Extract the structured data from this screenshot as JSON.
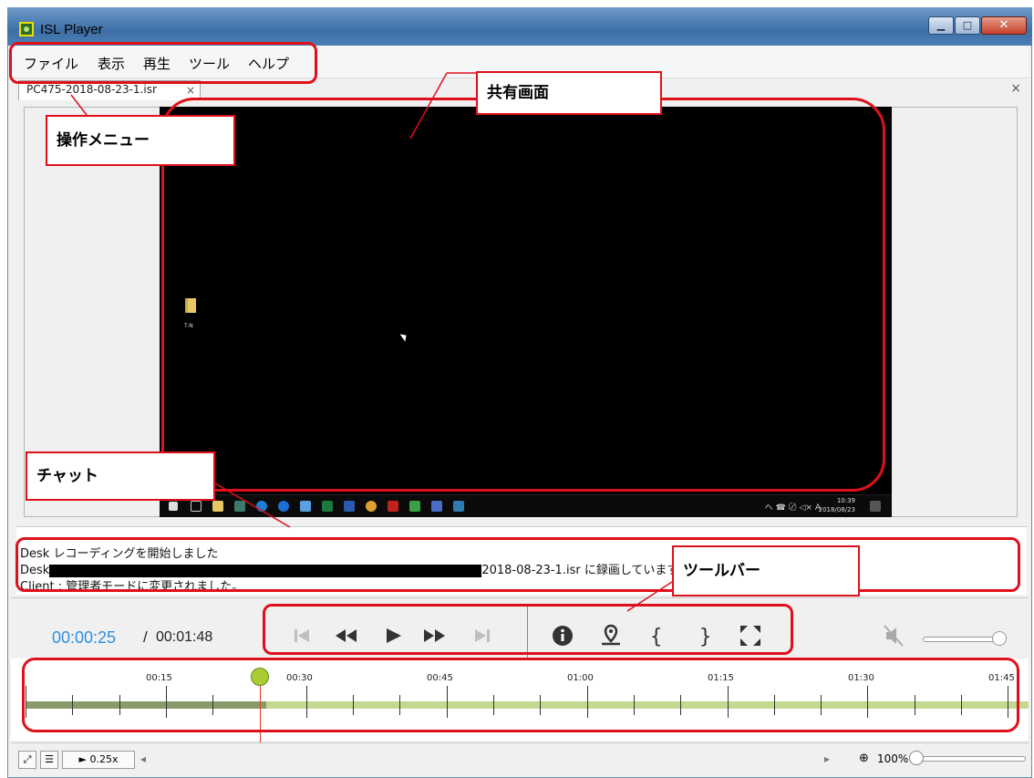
{
  "window": {
    "title": "ISL Player"
  },
  "menu": {
    "items": [
      "ファイル",
      "表示",
      "再生",
      "ツール",
      "ヘルプ"
    ]
  },
  "tab": {
    "label": "PC475-2018-08-23-1.isr",
    "close": "×"
  },
  "strip_close": "×",
  "desktop": {
    "folder_caption": "T-N",
    "clock_time": "10:39",
    "clock_date": "2018/08/23",
    "tray_text": "へ ☎ 〄 ◁× A"
  },
  "chat": {
    "lines": [
      {
        "prefix": "Desk ",
        "text": "レコーディングを開始しました"
      },
      {
        "prefix": "Desk",
        "suffix": "2018-08-23-1.isr に録画しています"
      },
      {
        "text": "Client : 管理者モードに変更されました。"
      }
    ]
  },
  "player": {
    "current_time": "00:00:25",
    "separator": "/",
    "total_time": "00:01:48"
  },
  "timeline": {
    "ticks": [
      "00:15",
      "00:30",
      "00:45",
      "01:00",
      "01:15",
      "01:30",
      "01:45"
    ],
    "playhead_time": "00:25"
  },
  "statusbar": {
    "speed_label": "► 0.25x",
    "zoom_label": "100%"
  },
  "annotations": {
    "operation_menu": "操作メニュー",
    "shared_screen": "共有画面",
    "chat": "チャット",
    "toolbar": "ツールバー"
  },
  "colors": {
    "accent_time": "#2e8fe0",
    "annotation": "#e0101a",
    "timeline_track": "#c3d98f",
    "playhead_knob": "#a8cc32"
  },
  "icons": [
    "skip-start-icon",
    "rewind-icon",
    "play-icon",
    "fast-forward-icon",
    "skip-end-icon",
    "info-icon",
    "bookmark-location-icon",
    "open-brace-icon",
    "close-brace-icon",
    "fullscreen-icon",
    "mute-icon"
  ]
}
